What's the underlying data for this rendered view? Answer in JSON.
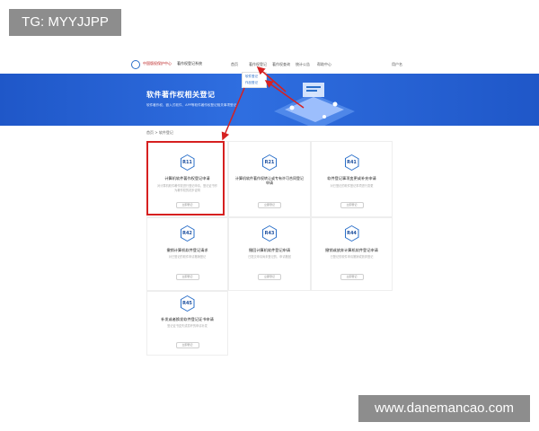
{
  "watermarks": {
    "top_left": "TG: MYYJJPP",
    "bottom_right": "www.danemancao.com"
  },
  "topnav": {
    "org_name": "中国版权保护中心",
    "portal_name": "著作权登记系统",
    "items": [
      "首页",
      "著作权登记",
      "著作权查询",
      "统计公告",
      "帮助中心"
    ],
    "user_label": "用户名"
  },
  "dropdown": {
    "items": [
      "软件登记",
      "作品登记"
    ]
  },
  "banner": {
    "title": "软件著作权相关登记",
    "subtitle": "软件著作权、嵌入式软件、APP等软件著作权登记相关事项登记"
  },
  "breadcrumb": "首页 > 软件登记",
  "cards": [
    {
      "code": "R11",
      "title": "计算机软件著作权登记申请",
      "desc": "对计算机软件著作权进行登记申请，登记证书作为著作权的初步证明",
      "button": "立即登记"
    },
    {
      "code": "R21",
      "title": "计算机软件著作权转让或专有许可合同登记申请",
      "desc": "",
      "button": "立即登记"
    },
    {
      "code": "R41",
      "title": "软件登记事项变更或补充申请",
      "desc": "对已登记的软件登记事项进行变更",
      "button": "立即登记"
    },
    {
      "code": "R42",
      "title": "撤销计算机软件登记请求",
      "desc": "对已登记的软件申请撤销登记",
      "button": "立即登记"
    },
    {
      "code": "R43",
      "title": "撤回计算机软件登记申请",
      "desc": "已提交申请尚未登记的，申请撤回",
      "button": "立即登记"
    },
    {
      "code": "R44",
      "title": "撤销或放弃计算机软件登记申请",
      "desc": "已登记的软件申请撤销或放弃登记",
      "button": "立即登记"
    },
    {
      "code": "R45",
      "title": "补发或者换发软件登记证书申请",
      "desc": "登记证书遗失或损坏的申请补发",
      "button": "立即登记"
    }
  ],
  "colors": {
    "brand_blue": "#2a6fc9",
    "banner_blue": "#1f57c8",
    "highlight_red": "#d62020"
  }
}
